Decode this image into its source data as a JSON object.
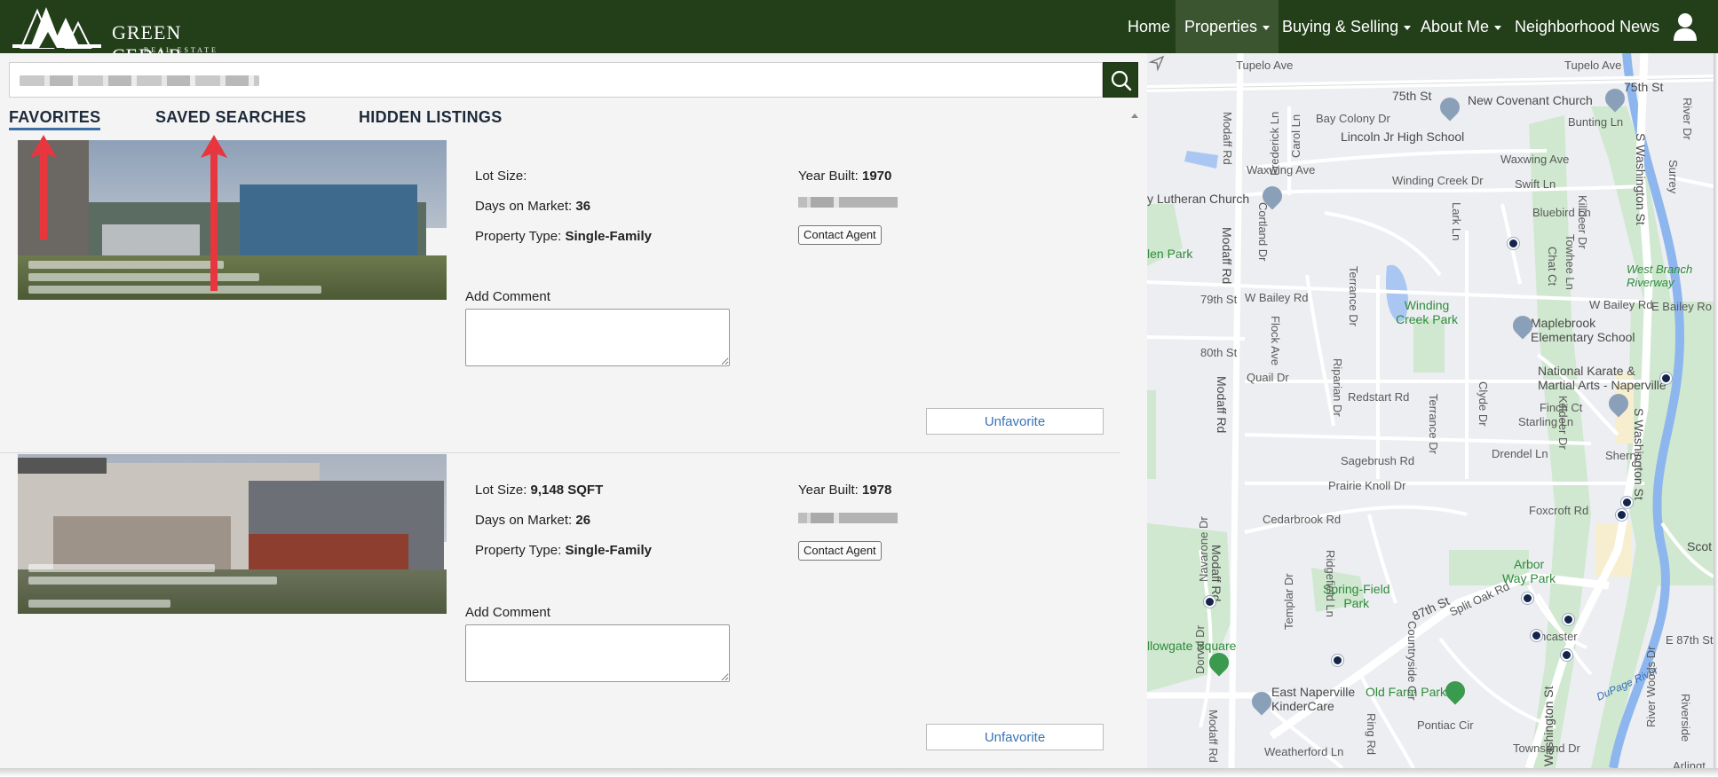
{
  "header": {
    "logo_text": "GREEN CEDAR",
    "logo_sub": "REAL ESTATE",
    "nav": [
      {
        "label": "Home",
        "dropdown": false
      },
      {
        "label": "Properties",
        "dropdown": true,
        "active": true
      },
      {
        "label": "Buying & Selling",
        "dropdown": true
      },
      {
        "label": "About Me",
        "dropdown": true
      },
      {
        "label": "Neighborhood News",
        "dropdown": false
      }
    ]
  },
  "search": {
    "placeholder": "",
    "value": ""
  },
  "tabs": [
    {
      "label": "FAVORITES",
      "active": true
    },
    {
      "label": "SAVED SEARCHES",
      "active": false
    },
    {
      "label": "HIDDEN LISTINGS",
      "active": false
    }
  ],
  "listings": [
    {
      "lot_size_label": "Lot Size:",
      "lot_size_value": "",
      "year_built_label": "Year Built:",
      "year_built_value": "1970",
      "days_label": "Days on Market:",
      "days_value": "36",
      "type_label": "Property Type:",
      "type_value": "Single-Family",
      "contact_label": "Contact Agent",
      "comment_label": "Add Comment",
      "unfavorite_label": "Unfavorite"
    },
    {
      "lot_size_label": "Lot Size:",
      "lot_size_value": "9,148 SQFT",
      "year_built_label": "Year Built:",
      "year_built_value": "1978",
      "days_label": "Days on Market:",
      "days_value": "26",
      "type_label": "Property Type:",
      "type_value": "Single-Family",
      "contact_label": "Contact Agent",
      "comment_label": "Add Comment",
      "unfavorite_label": "Unfavorite"
    }
  ],
  "map": {
    "labels": {
      "tupelo_top": "Tupelo Ave",
      "tupelo_right": "Tupelo Ave",
      "st75_left": "75th St",
      "st75_right": "75th St",
      "new_covenant": "New Covenant Church",
      "bay_colony": "Bay Colony Dr",
      "bunting": "Bunting Ln",
      "lincoln_jr": "Lincoln Jr High School",
      "waxwing_ave_left": "Waxwing Ave",
      "waxwing_ave_right": "Waxwing Ave",
      "winding_creek_dr": "Winding Creek Dr",
      "swift_ln": "Swift Ln",
      "lutheran": "y Lutheran Church",
      "bluebird": "Bluebird Ln",
      "modaff_rd_1": "Modaff Rd",
      "modaff_rd_2": "Modaff Rd",
      "modaff_rd_3": "Modaff Rd",
      "modaff_rd_4": "Modaff Rd",
      "modaff_rd_5": "Modaff Rd",
      "glen_park": "len Park",
      "w_bailey_rd": "W Bailey Rd",
      "w_bailey_rd_right": "W Bailey Rd",
      "e_bailey_rd": "E Bailey Ro",
      "st79": "79th St",
      "winding_creek_park": "Winding\nCreek Park",
      "maplebrook": "Maplebrook\nElementary School",
      "west_branch": "West Branch\nRiverway",
      "st80": "80th St",
      "quail_dr": "Quail Dr",
      "national_karate": "National Karate &\nMartial Arts - Naperville",
      "redstart": "Redstart Rd",
      "finch": "Finch Ct",
      "starling": "Starling Ln",
      "drendel": "Drendel Ln",
      "sherry": "Sherry",
      "sagebrush": "Sagebrush Rd",
      "prairie_knoll": "Prairie Knoll Dr",
      "cedarbrook": "Cedarbrook Rd",
      "foxcroft": "Foxcroft Rd",
      "scot": "Scot",
      "arbor_way": "Arbor\nWay Park",
      "spring_field": "Spring-Field\nPark",
      "st87": "87th St",
      "split_oak": "Split Oak Rd",
      "e87th": "E 87th St",
      "willowgate": "llowgate Square",
      "east_naperville": "East Naperville\nKinderCare",
      "old_farm_park": "Old Farm Park",
      "dupage_river": "DuPage River",
      "s_washington_1": "S Washington St",
      "s_washington_2": "S Washington St",
      "s_washington_3": "Washington St",
      "weatherford": "Weatherford Ln",
      "townsend": "Townsend Dr",
      "ring_rd": "Ring Rd",
      "pontiac": "Pontiac Cir",
      "countryside": "Countryside Cir",
      "arlington": "Arlingt",
      "navarone": "Navarone Dr",
      "dorval": "Dorval Dr",
      "templar": "Templar Dr",
      "ridgefield": "Ridgefield Ln",
      "frederick": "Frederick Ln",
      "carol": "Carol Ln",
      "lark": "Lark Ln",
      "killdeer_1": "Killdeer Dr",
      "killdeer_2": "Killdeer Dr",
      "towhee": "Towhee Ln",
      "chat": "Chat Ct",
      "river_dr": "River Dr",
      "cortland": "Cortland Dr",
      "flock": "Flock Ave",
      "terrance_1": "Terrance Dr",
      "terrance_2": "Terrance Dr",
      "riparian": "Riparian Dr",
      "clyde": "Clyde Dr",
      "surrey": "Surrey",
      "river_woods": "River Woods Dr",
      "riverside": "Riverside",
      "lancaster": "ncaster"
    }
  }
}
